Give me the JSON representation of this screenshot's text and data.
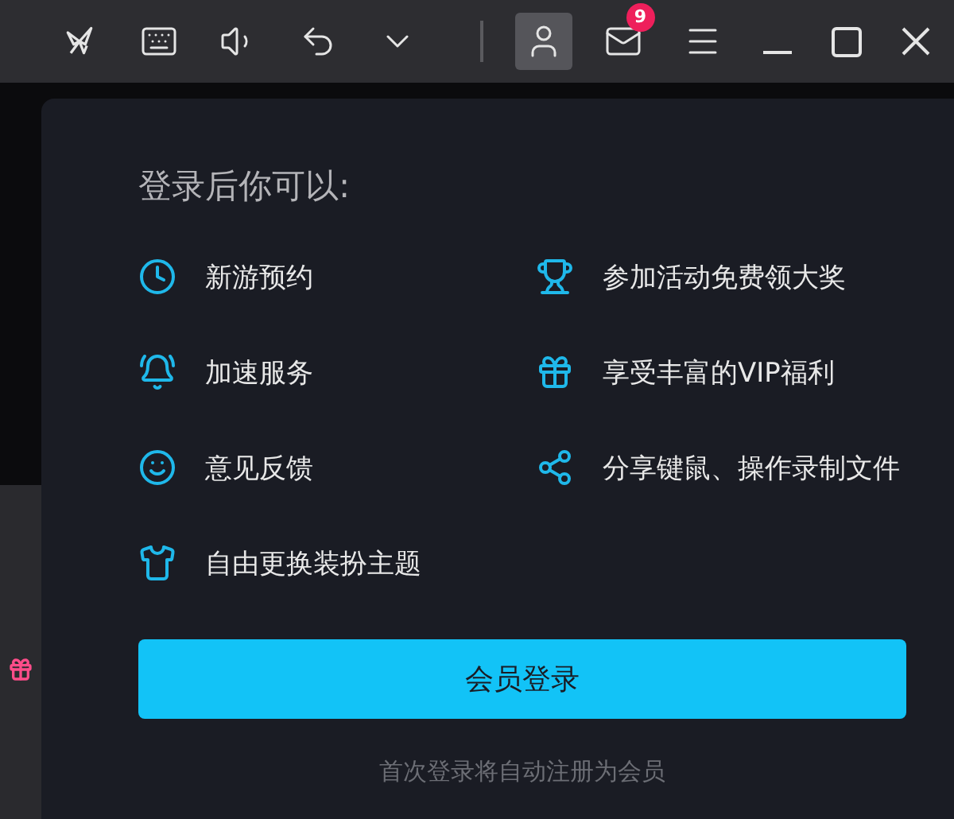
{
  "toolbar": {
    "buttons": [
      {
        "selected": false
      },
      {
        "selected": false
      },
      {
        "selected": false
      },
      {
        "selected": false
      },
      {
        "selected": false
      },
      {
        "selected": true
      },
      {
        "selected": false,
        "badge": "9"
      },
      {
        "selected": false
      }
    ]
  },
  "login_panel": {
    "heading": "登录后你可以:",
    "left_features": [
      "新游预约",
      "加速服务",
      "意见反馈",
      "自由更换装扮主题"
    ],
    "right_features": [
      "参加活动免费领大奖",
      "享受丰富的VIP福利",
      "分享键鼠、操作录制文件"
    ],
    "login_button": "会员登录",
    "note": "首次登录将自动注册为会员"
  }
}
